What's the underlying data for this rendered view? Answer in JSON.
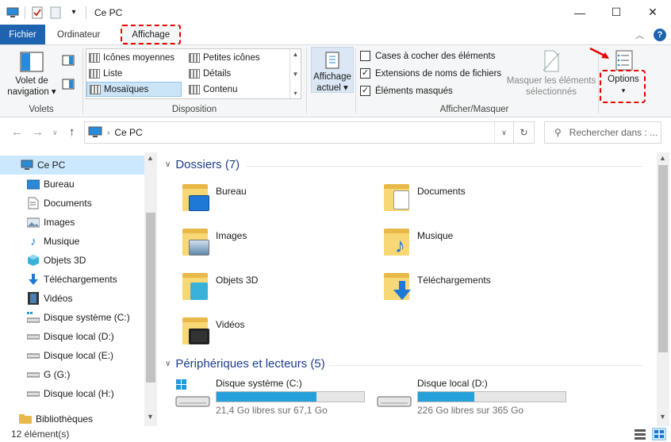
{
  "title": "Ce PC",
  "window_controls": {
    "minimize": "—",
    "maximize": "☐",
    "close": "✕"
  },
  "tabs": [
    {
      "label": "Fichier"
    },
    {
      "label": "Ordinateur"
    },
    {
      "label": "Affichage"
    }
  ],
  "ribbon": {
    "volets": {
      "nav_label_1": "Volet de",
      "nav_label_2": "navigation",
      "group_label": "Volets"
    },
    "disposition": {
      "items": [
        "Icônes moyennes",
        "Petites icônes",
        "Liste",
        "Détails",
        "Mosaïques",
        "Contenu"
      ],
      "selected": "Mosaïques",
      "group_label": "Disposition"
    },
    "affichage_actuel": {
      "label_1": "Affichage",
      "label_2": "actuel"
    },
    "afficher_masquer": {
      "checkboxes": [
        {
          "label": "Cases à cocher des éléments",
          "checked": false
        },
        {
          "label": "Extensions de noms de fichiers",
          "checked": true
        },
        {
          "label": "Éléments masqués",
          "checked": true
        }
      ],
      "hide_label_1": "Masquer les éléments",
      "hide_label_2": "sélectionnés",
      "group_label": "Afficher/Masquer"
    },
    "options": {
      "label": "Options"
    }
  },
  "address": {
    "path": "Ce PC",
    "search_placeholder": "Rechercher dans : ..."
  },
  "sidebar": {
    "items": [
      {
        "label": "Ce PC",
        "icon": "pc-icon",
        "selected": true
      },
      {
        "label": "Bureau",
        "icon": "desktop-icon"
      },
      {
        "label": "Documents",
        "icon": "documents-icon"
      },
      {
        "label": "Images",
        "icon": "images-icon"
      },
      {
        "label": "Musique",
        "icon": "music-icon"
      },
      {
        "label": "Objets 3D",
        "icon": "objects3d-icon"
      },
      {
        "label": "Téléchargements",
        "icon": "downloads-icon"
      },
      {
        "label": "Vidéos",
        "icon": "videos-icon"
      },
      {
        "label": "Disque système (C:)",
        "icon": "system-drive-icon"
      },
      {
        "label": "Disque local (D:)",
        "icon": "drive-icon"
      },
      {
        "label": "Disque local (E:)",
        "icon": "drive-icon"
      },
      {
        "label": "G (G:)",
        "icon": "drive-icon"
      },
      {
        "label": "Disque local (H:)",
        "icon": "drive-icon"
      },
      {
        "label": "Bibliothèques",
        "icon": "libraries-icon"
      }
    ]
  },
  "main": {
    "folders_header": "Dossiers (7)",
    "folders": [
      {
        "label": "Bureau"
      },
      {
        "label": "Documents"
      },
      {
        "label": "Images"
      },
      {
        "label": "Musique"
      },
      {
        "label": "Objets 3D"
      },
      {
        "label": "Téléchargements"
      },
      {
        "label": "Vidéos"
      }
    ],
    "devices_header": "Périphériques et lecteurs (5)",
    "drives": [
      {
        "label": "Disque système (C:)",
        "free": "21,4 Go libres sur 67,1 Go",
        "used_fraction": 0.68
      },
      {
        "label": "Disque local (D:)",
        "free": "226 Go libres sur 365 Go",
        "used_fraction": 0.38
      }
    ]
  },
  "status": {
    "count": "12 élément(s)"
  },
  "colors": {
    "accent": "#1e63b0",
    "highlight": "#e00000",
    "bar": "#26a0da",
    "selection": "#cce8ff"
  }
}
